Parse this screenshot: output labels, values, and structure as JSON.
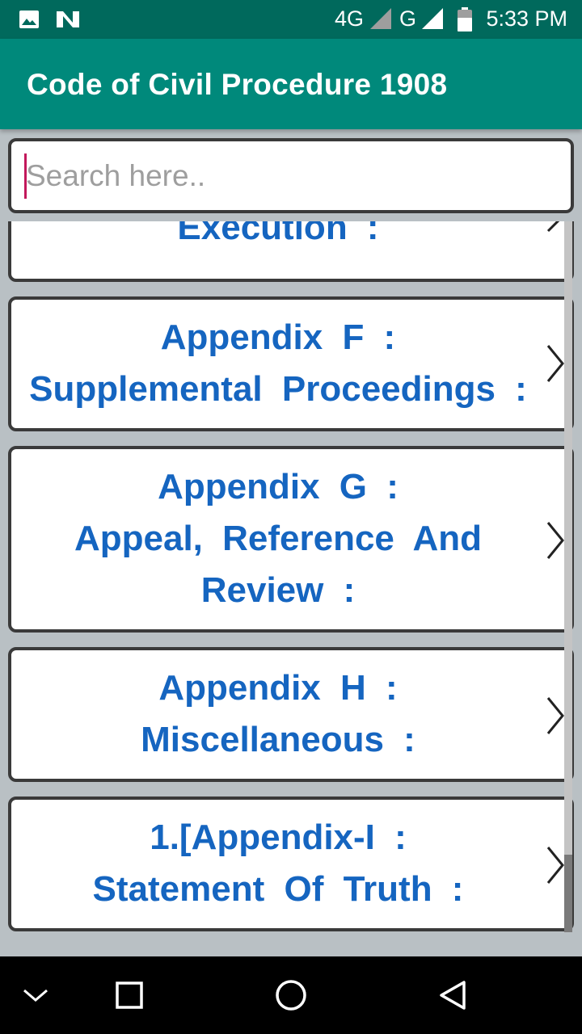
{
  "status_bar": {
    "time": "5:33 PM",
    "network_1": "4G",
    "network_2": "G",
    "icons": [
      "image-icon",
      "notification-n-icon",
      "signal-icon",
      "battery-icon"
    ]
  },
  "app_bar": {
    "title": "Code of Civil Procedure 1908"
  },
  "search": {
    "placeholder": "Search here..",
    "value": ""
  },
  "list": {
    "items": [
      {
        "lines": [
          "Execution :"
        ]
      },
      {
        "lines": [
          "Appendix F :",
          "Supplemental Proceedings :"
        ]
      },
      {
        "lines": [
          "Appendix G :",
          "Appeal, Reference And",
          "Review :"
        ]
      },
      {
        "lines": [
          "Appendix H :",
          "Miscellaneous :"
        ]
      },
      {
        "lines": [
          "1.[Appendix-I :",
          "Statement Of Truth :"
        ]
      }
    ]
  },
  "colors": {
    "status_bar": "#00695c",
    "app_bar": "#00897b",
    "item_text": "#1565c0",
    "background": "#b9c0c4"
  },
  "nav": {
    "icons": [
      "chevron-down-icon",
      "recents-icon",
      "home-icon",
      "back-icon"
    ]
  }
}
